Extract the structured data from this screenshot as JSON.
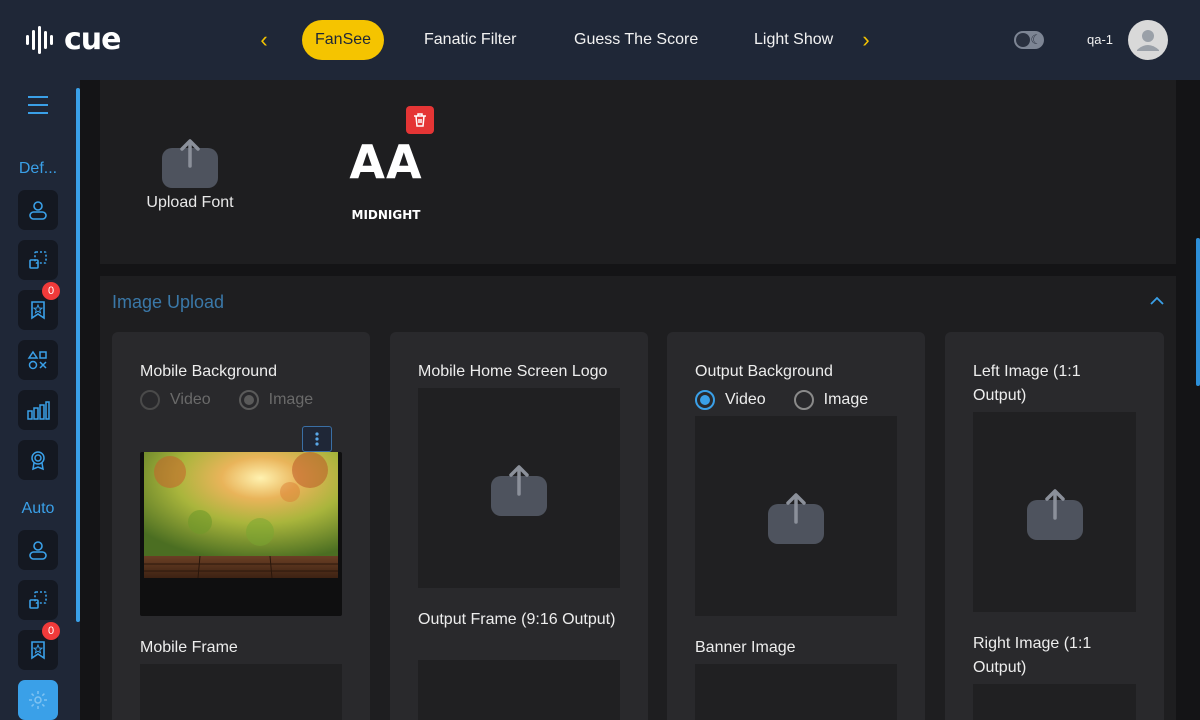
{
  "brand": {
    "name": "cue"
  },
  "nav": {
    "tabs": [
      {
        "label": "FanSee",
        "active": true
      },
      {
        "label": "Fanatic Filter"
      },
      {
        "label": "Guess The Score"
      },
      {
        "label": "Light Show"
      }
    ]
  },
  "user": {
    "name": "qa-1"
  },
  "sidebar": {
    "sections": [
      {
        "label": "Def..."
      },
      {
        "label": "Auto"
      }
    ],
    "badges": [
      "0",
      "0"
    ]
  },
  "fonts": {
    "upload_label": "Upload Font",
    "sample_glyphs": "AA",
    "sample_name": "MIDNIGHT"
  },
  "image_upload": {
    "title": "Image Upload",
    "cards": [
      {
        "label": "Mobile Background",
        "options": [
          "Video",
          "Image"
        ],
        "selected": "Image",
        "second_label": "Mobile Frame"
      },
      {
        "label": "Mobile Home Screen Logo",
        "second_label": "Output Frame (9:16 Output)"
      },
      {
        "label": "Output Background",
        "options": [
          "Video",
          "Image"
        ],
        "selected": "Video",
        "second_label": "Banner Image"
      },
      {
        "label": "Left Image (1:1 Output)",
        "second_label": "Right Image (1:1 Output)"
      }
    ]
  },
  "colors": {
    "accent": "#f5c400",
    "primary": "#3aa0e8",
    "topbar": "#1f2737",
    "danger": "#e53535"
  }
}
